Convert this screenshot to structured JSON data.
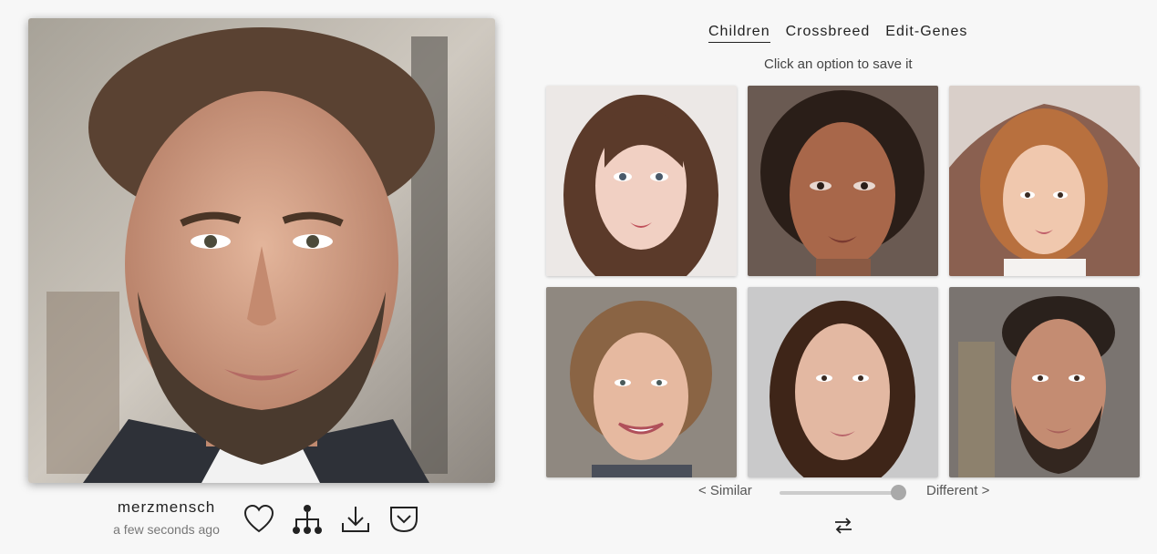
{
  "profile": {
    "username": "merzmensch",
    "timestamp": "a few seconds ago",
    "portrait": "bearded man portrait"
  },
  "actions": [
    {
      "icon": "heart-icon"
    },
    {
      "icon": "family-tree-icon"
    },
    {
      "icon": "download-icon"
    },
    {
      "icon": "pocket-save-icon"
    }
  ],
  "tabs": [
    {
      "label": "Children",
      "active": true
    },
    {
      "label": "Crossbreed",
      "active": false
    },
    {
      "label": "Edit-Genes",
      "active": false
    }
  ],
  "hint": "Click an option to save it",
  "children": [
    {
      "description": "painted woman with long brown hair"
    },
    {
      "description": "painted face with dark curly hair"
    },
    {
      "description": "woman with auburn bob and headscarf"
    },
    {
      "description": "smiling woman with curly hair"
    },
    {
      "description": "woman with long dark hair"
    },
    {
      "description": "bearded man"
    }
  ],
  "slider": {
    "left_label": "< Similar",
    "right_label": "Different >",
    "value_percent": 100
  },
  "colors": {
    "background": "#f7f7f7",
    "text": "#222222",
    "muted": "#777777",
    "slider_thumb": "#a9a9a9"
  }
}
